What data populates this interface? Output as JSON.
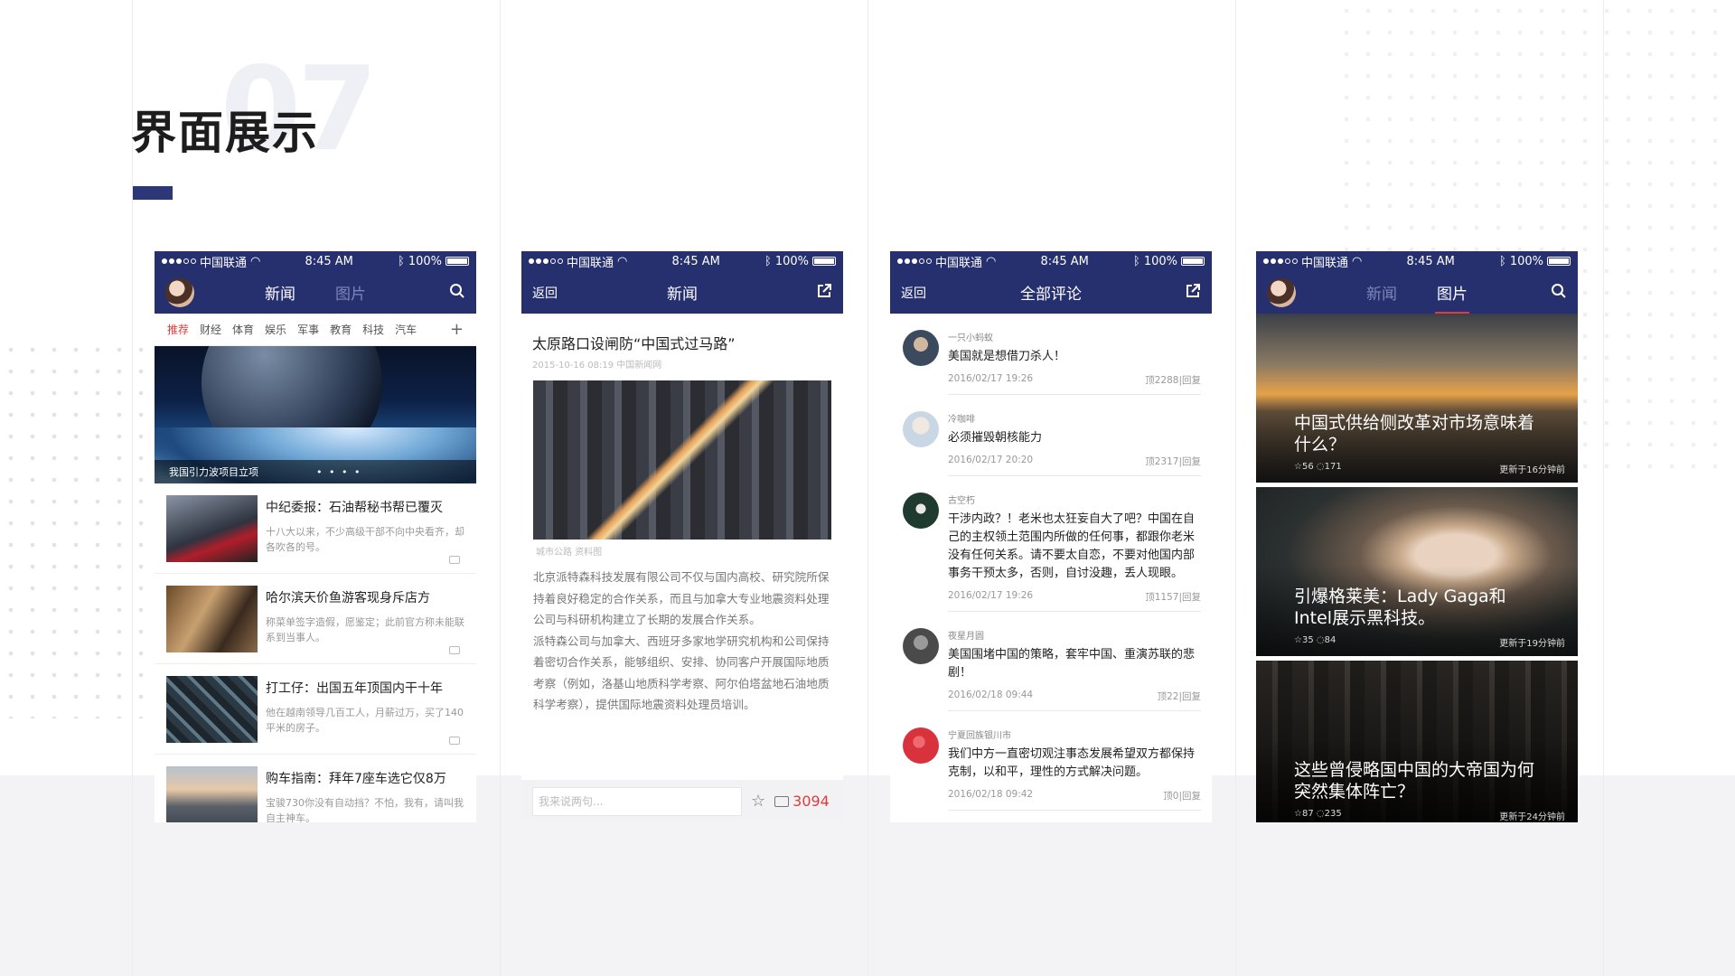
{
  "section": {
    "number": "07",
    "title": "界面展示"
  },
  "status": {
    "carrier": "中国联通",
    "time": "8:45 AM",
    "battery": "100%"
  },
  "phone1": {
    "tabs": [
      "新闻",
      "图片"
    ],
    "categories": [
      "推荐",
      "财经",
      "体育",
      "娱乐",
      "军事",
      "教育",
      "科技",
      "汽车"
    ],
    "plus": "+",
    "banner_caption": "我国引力波项目立项",
    "banner_dots": "• • • •",
    "news": [
      {
        "title": "中纪委报：石油帮秘书帮已覆灭",
        "desc": "十八大以来，不少高级干部不向中央看齐，却各吹各的号。"
      },
      {
        "title": "哈尔滨天价鱼游客现身斥店方",
        "desc": "称菜单签字造假，愿鉴定；此前官方称未能联系到当事人。"
      },
      {
        "title": "打工仔：出国五年顶国内干十年",
        "desc": "他在越南领导几百工人，月薪过万，买了140平米的房子。"
      },
      {
        "title": "购车指南：拜年7座车选它仅8万",
        "desc": "宝骏730你没有自动挡？不怕，我有，请叫我自主神车。"
      }
    ]
  },
  "phone2": {
    "back": "返回",
    "title": "新闻",
    "article_title": "太原路口设闸防“中国式过马路”",
    "article_meta": "2015-10-16 08:19 中国新闻网",
    "image_caption": "城市公路 资料图",
    "body1": "北京派特森科技发展有限公司不仅与国内高校、研究院所保持着良好稳定的合作关系，而且与加拿大专业地震资料处理公司与科研机构建立了长期的发展合作关系。",
    "body2": "派特森公司与加拿大、西班牙多家地学研究机构和公司保持着密切合作关系，能够组织、安排、协同客户开展国际地质考察（例如，洛基山地质科学考察、阿尔伯塔盆地石油地质科学考察），提供国际地震资料处理员培训。",
    "input_placeholder": "我来说两句...",
    "comment_count": "3094"
  },
  "phone3": {
    "back": "返回",
    "title": "全部评论",
    "comments": [
      {
        "user": "一只小蚂蚁",
        "text": "美国就是想借刀杀人！",
        "time": "2016/02/17 19:26",
        "stats": "顶2288|回复",
        "color": "#3c4a5e"
      },
      {
        "user": "冷咖啡",
        "text": "必须摧毁朝核能力",
        "time": "2016/02/17 20:20",
        "stats": "顶2317|回复",
        "color": "#c9d6e4"
      },
      {
        "user": "古空朽",
        "text": "干涉内政？！老米也太狂妄自大了吧？中国在自己的主权领土范围内所做的任何事，都跟你老米没有任何关系。请不要太自恋，不要对他国内部事务干预太多，否则，自讨没趣，丢人现眼。",
        "time": "2016/02/17 19:26",
        "stats": "顶1157|回复",
        "color": "#1f3a2f"
      },
      {
        "user": "夜星月圆",
        "text": "美国围堵中国的策略，套牢中国、重演苏联的悲剧！",
        "time": "2016/02/18 09:44",
        "stats": "顶22|回复",
        "color": "#5a5a5a"
      },
      {
        "user": "宁夏回族银川市",
        "text": "我们中方一直密切观注事态发展希望双方都保持克制，以和平，理性的方式解决问题。",
        "time": "2016/02/18 09:42",
        "stats": "顶0|回复",
        "color": "#d8323c"
      }
    ]
  },
  "phone4": {
    "tabs": [
      "新闻",
      "图片"
    ],
    "pics": [
      {
        "title": "中国式供给侧改革对市场意味着什么？",
        "stars": "56",
        "comments": "171",
        "updated": "更新于16分钟前"
      },
      {
        "title": "引爆格莱美：Lady Gaga和Intel展示黑科技。",
        "stars": "35",
        "comments": "84",
        "updated": "更新于19分钟前"
      },
      {
        "title": "这些曾侵略国中国的大帝国为何突然集体阵亡？",
        "stars": "87",
        "comments": "235",
        "updated": "更新于24分钟前"
      }
    ]
  },
  "colors": {
    "nav": "#27306e",
    "accent": "#e03a3a",
    "title_bar": "#2c3777"
  }
}
